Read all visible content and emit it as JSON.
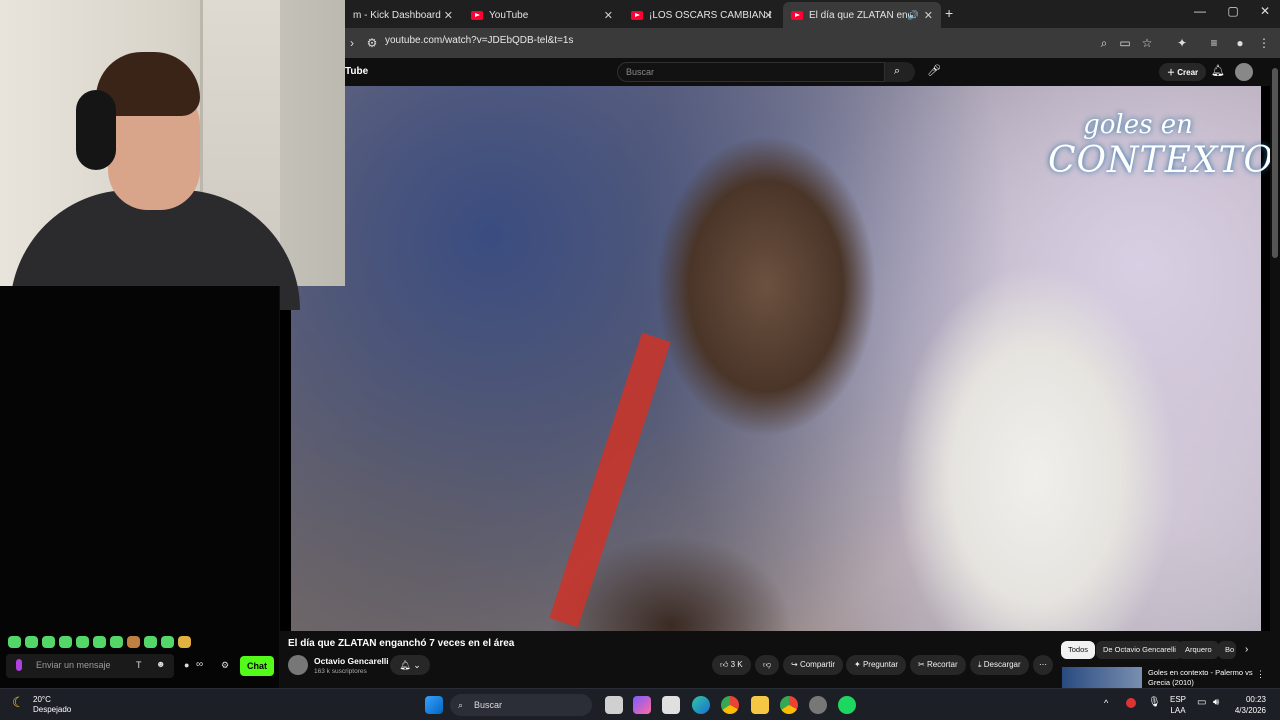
{
  "browser": {
    "tabs": [
      {
        "label": "m - Kick Dashboard"
      },
      {
        "label": "YouTube"
      },
      {
        "label": "¡LOS OSCARS CAMBIAN POR C"
      },
      {
        "label": "El día que ZLATAN enganch"
      }
    ],
    "url": "youtube.com/watch?v=JDEbQDB-tel&t=1s",
    "new_tab": "+",
    "close_glyph": "✕"
  },
  "youtube": {
    "logo": "Tube",
    "search_placeholder": "Buscar",
    "create_label": "Crear",
    "watermark_line1": "goles en",
    "watermark_line2": "CONTEXTO",
    "video_title": "El día que ZLATAN enganchó 7 veces en el área",
    "channel_name": "Octavio Gencarelli",
    "channel_subs": "163 k suscriptores",
    "likes": "3 K",
    "share": "Compartir",
    "ask": "Preguntar",
    "clip": "Recortar",
    "download": "Descargar",
    "chips": [
      "Todos",
      "De Octavio Gencarelli",
      "Arquero",
      "Bo"
    ],
    "rec_title": "Goles en contexto - Palermo vs Grecia (2010)"
  },
  "chat": {
    "placeholder": "Enviar un mensaje",
    "send_label": "Chat",
    "infinity": "∞"
  },
  "taskbar": {
    "temp": "20°C",
    "weather": "Despejado",
    "search": "Buscar",
    "lang1": "ESP",
    "lang2": "LAA",
    "time": "00:23",
    "date": "4/3/2026"
  },
  "colors": {
    "kick_green": "#53fc18",
    "yt_red": "#ff0033"
  }
}
